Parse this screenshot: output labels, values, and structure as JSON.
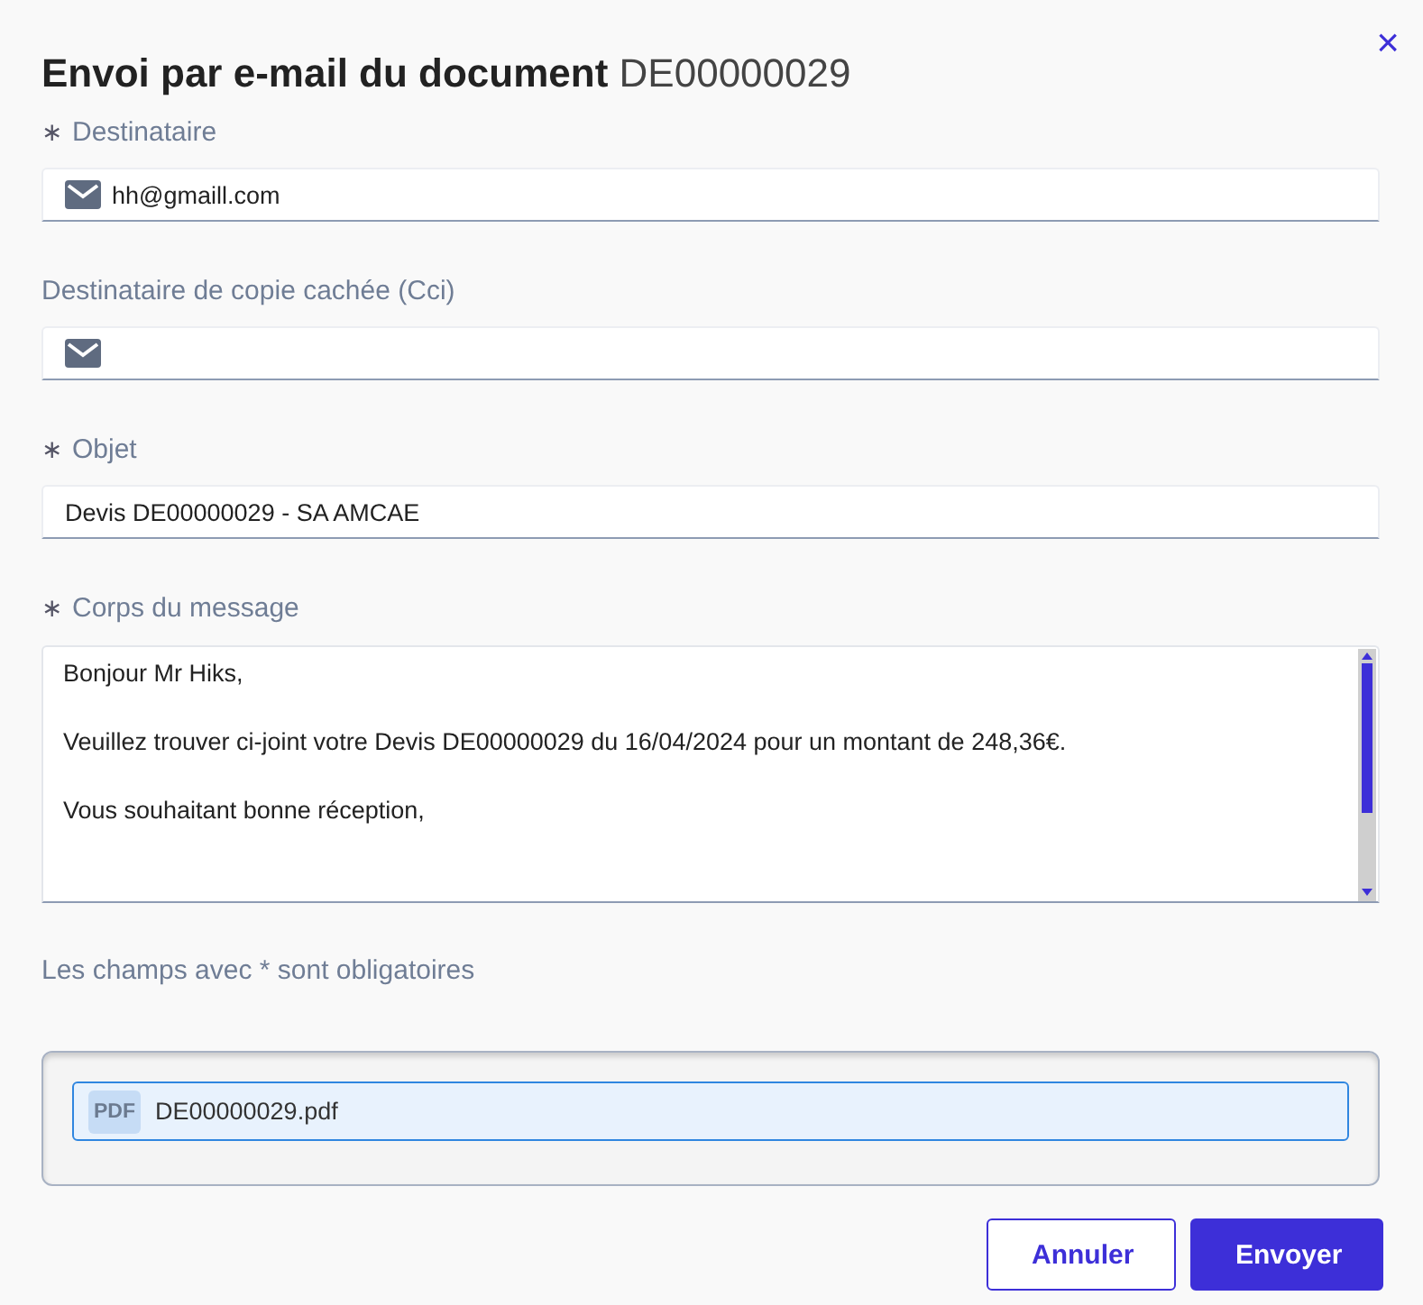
{
  "dialog": {
    "title": "Envoi par e-mail du document",
    "document_number": "DE00000029",
    "close": "×"
  },
  "fields": [
    {
      "kind": "email",
      "label": "Destinataire",
      "required_mark": "∗",
      "value": "hh@gmaill.com"
    },
    {
      "kind": "email",
      "label": "Destinataire de copie cachée (Cci)"
    },
    {
      "kind": "text",
      "label": "Objet",
      "required_mark": "∗",
      "value": "Devis DE00000029 - SA AMCAE"
    }
  ],
  "message": {
    "label": "Corps du message",
    "required_mark": "∗",
    "paragraphs": [
      "Bonjour Mr Hiks,",
      "Veuillez trouver ci-joint votre Devis DE00000029 du 16/04/2024 pour un montant de 248,36€.",
      "Vous souhaitant bonne réception,"
    ]
  },
  "note": "Les champs avec * sont obligatoires",
  "attachments": [
    {
      "badge": "PDF",
      "name": "DE00000029.pdf",
      "selected": true
    }
  ],
  "buttons": [
    {
      "kind": "secondary",
      "label": "Annuler"
    },
    {
      "kind": "primary",
      "label": "Envoyer"
    }
  ]
}
